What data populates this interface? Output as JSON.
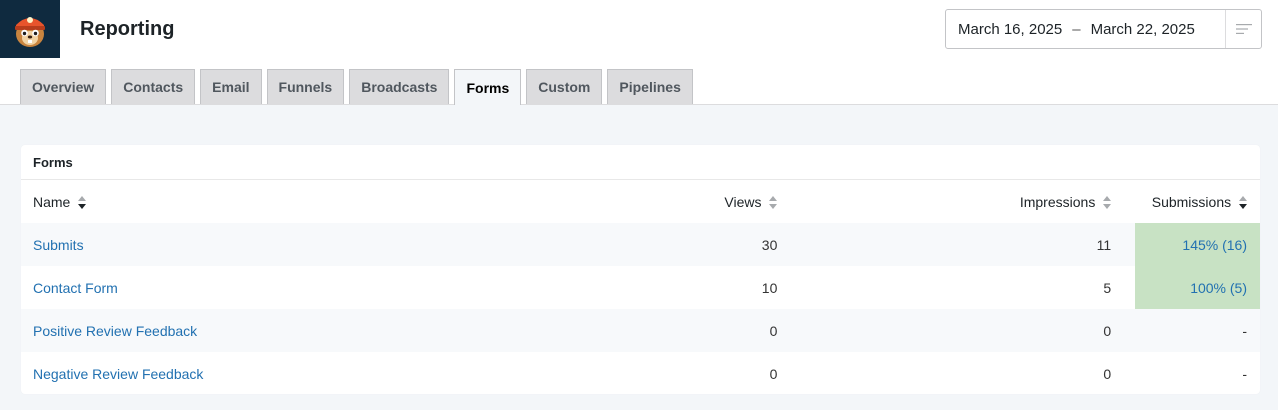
{
  "header": {
    "title": "Reporting",
    "date_start": "March 16, 2025",
    "date_sep": "–",
    "date_end": "March 22, 2025"
  },
  "tabs": [
    {
      "label": "Overview",
      "active": false
    },
    {
      "label": "Contacts",
      "active": false
    },
    {
      "label": "Email",
      "active": false
    },
    {
      "label": "Funnels",
      "active": false
    },
    {
      "label": "Broadcasts",
      "active": false
    },
    {
      "label": "Forms",
      "active": true
    },
    {
      "label": "Custom",
      "active": false
    },
    {
      "label": "Pipelines",
      "active": false
    }
  ],
  "card": {
    "title": "Forms",
    "columns": {
      "name": "Name",
      "views": "Views",
      "impressions": "Impressions",
      "submissions": "Submissions"
    },
    "rows": [
      {
        "name": "Submits",
        "views": "30",
        "impressions": "11",
        "submissions": "145% (16)"
      },
      {
        "name": "Contact Form",
        "views": "10",
        "impressions": "5",
        "submissions": "100% (5)"
      },
      {
        "name": "Positive Review Feedback",
        "views": "0",
        "impressions": "0",
        "submissions": "-"
      },
      {
        "name": "Negative Review Feedback",
        "views": "0",
        "impressions": "0",
        "submissions": "-"
      }
    ]
  },
  "colors": {
    "highlight": "#c8e2c4",
    "link": "#2271b1",
    "logo_bg": "#0f2a3f"
  }
}
